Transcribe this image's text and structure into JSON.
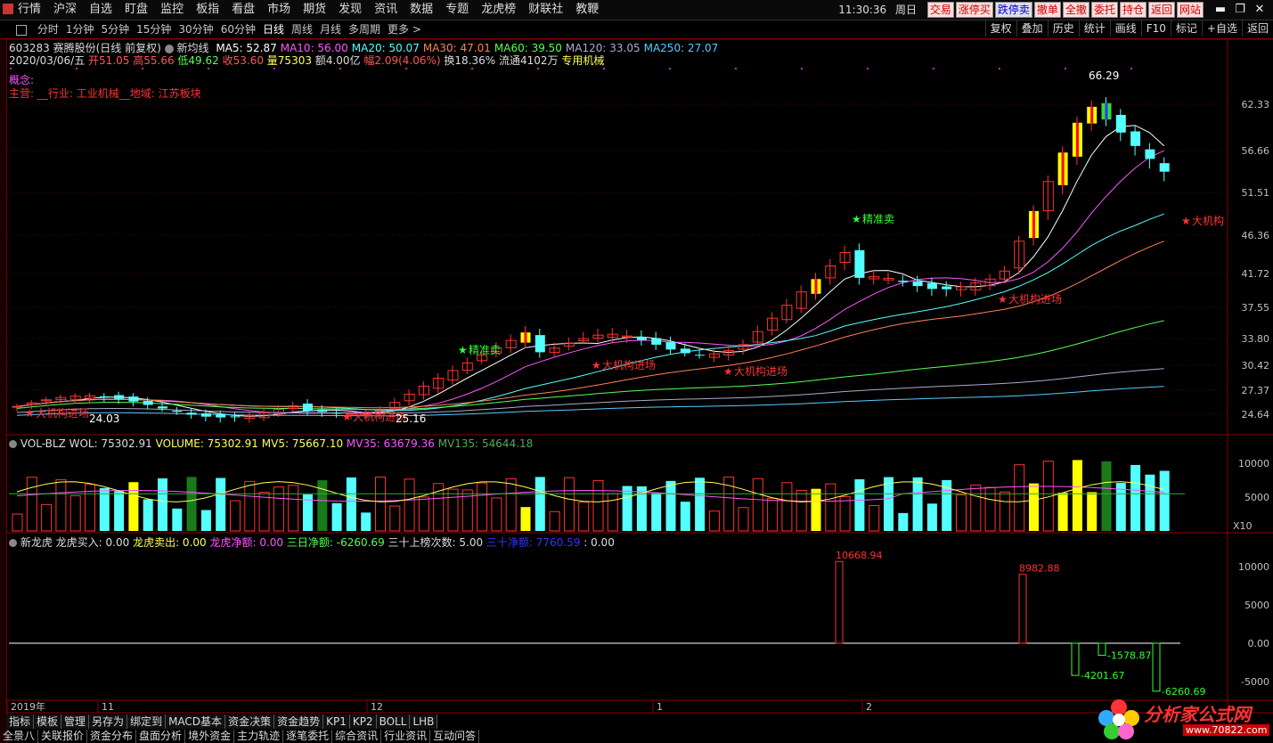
{
  "menu": [
    "行情",
    "沪深",
    "自选",
    "盯盘",
    "监控",
    "板指",
    "看盘",
    "市场",
    "期货",
    "发现",
    "资讯",
    "数据",
    "专题",
    "龙虎榜",
    "财联社",
    "教鞭"
  ],
  "clock": "11:30:36",
  "weekday": "周日",
  "trade_buttons": [
    "交易",
    "涨停买",
    "跌停卖",
    "撤单",
    "全撤",
    "委托",
    "持仓",
    "返回",
    "网站"
  ],
  "periods": [
    "分时",
    "1分钟",
    "5分钟",
    "15分钟",
    "30分钟",
    "60分钟",
    "日线",
    "周线",
    "月线",
    "多周期",
    "更多 >"
  ],
  "active_period": "日线",
  "right_tools": [
    "复权",
    "叠加",
    "历史",
    "统计",
    "画线",
    "F10",
    "标记",
    "+自选",
    "返回"
  ],
  "stock": {
    "code_name": "603283 赛腾股份(日线 前复权)",
    "indicator_name": "新均线",
    "ma": [
      {
        "label": "MA5: 52.87",
        "color": "#ffffff"
      },
      {
        "label": "MA10: 56.00",
        "color": "#ff55ff"
      },
      {
        "label": "MA20: 50.07",
        "color": "#55ffff"
      },
      {
        "label": "MA30: 47.01",
        "color": "#ff7f55"
      },
      {
        "label": "MA60: 39.50",
        "color": "#55ff55"
      },
      {
        "label": "MA120: 33.05",
        "color": "#aaaacc"
      },
      {
        "label": "MA250: 27.07",
        "color": "#55ccff"
      }
    ],
    "date": "2020/03/06/五",
    "open": "开51.05",
    "high": "高55.66",
    "low": "低49.62",
    "close": "收53.60",
    "vol": "量75303",
    "amount": "额4.00亿",
    "change": "幅2.09(4.06%)",
    "turnover": "换18.36%",
    "float": "流通4102万",
    "sector": "专用机械",
    "concept": "概念:",
    "business": "主营: __行业: 工业机械__地域: 江苏板块"
  },
  "price_axis": [
    "62.33",
    "56.66",
    "51.51",
    "46.36",
    "41.72",
    "37.55",
    "33.80",
    "30.42",
    "27.37",
    "24.64"
  ],
  "price_annotations": {
    "high": "66.29",
    "low1": "24.03",
    "low2": "25.16"
  },
  "signals": {
    "buy": "大机构进场",
    "buy_cut": "大机构",
    "sell": "精准卖",
    "sell_short": "精准卖"
  },
  "vol_panel": {
    "name": "VOL-BLZ",
    "wol": "WOL: 75302.91",
    "volume": "VOLUME: 75302.91",
    "mv5": "MV5: 75667.10",
    "mv35": "MV35: 63679.36",
    "mv135": "MV135: 54644.18",
    "axis": [
      "10000",
      "5000"
    ],
    "unit": "X10"
  },
  "dragon_panel": {
    "name": "新龙虎",
    "buy": "龙虎买入: 0.00",
    "sell": "龙虎卖出: 0.00",
    "net": "龙虎净额: 0.00",
    "three_day": "三日净额: -6260.69",
    "count30": "三十上榜次数: 5.00",
    "net30": "三十净额: 7760.59",
    "extra": ": 0.00",
    "axis": [
      "10000",
      "5000",
      "0.00",
      "-5000"
    ],
    "bar_labels": [
      "10668.94",
      "8982.88",
      "-4201.67",
      "-1578.87",
      "-6260.69"
    ]
  },
  "time_axis": [
    "2019年",
    "11",
    "12",
    "1",
    "2"
  ],
  "bottom_tabs": [
    "指标",
    "模板",
    "管理",
    "另存为",
    "绑定到",
    "MACD基本",
    "资金决策",
    "资金趋势",
    "KP1",
    "KP2",
    "BOLL",
    "LHB"
  ],
  "bottom_tabs2": [
    "全景八",
    "关联报价",
    "资金分布",
    "盘面分析",
    "境外资金",
    "主力轨迹",
    "逐笔委托",
    "综合资讯",
    "行业资讯",
    "互动问答"
  ],
  "logo": {
    "text": "分析家公式网",
    "url": "www.70822.com"
  }
}
